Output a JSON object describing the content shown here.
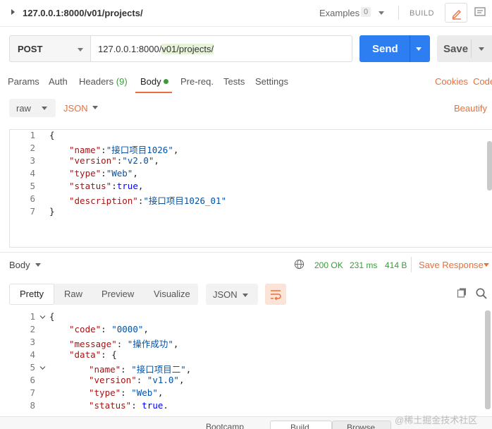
{
  "title_bar": {
    "request_title": "127.0.0.1:8000/v01/projects/",
    "examples_label": "Examples",
    "examples_count": "0",
    "build_label": "BUILD"
  },
  "request": {
    "method": "POST",
    "url_prefix": "127.0.0.1:8000/",
    "url_highlight": "v01/projects/",
    "send_label": "Send",
    "save_label": "Save"
  },
  "request_tabs": {
    "params": "Params",
    "auth": "Auth",
    "headers": "Headers",
    "headers_count": "(9)",
    "body": "Body",
    "prereq": "Pre-req.",
    "tests": "Tests",
    "settings": "Settings",
    "cookies": "Cookies",
    "code": "Code"
  },
  "body_options": {
    "mode": "raw",
    "type": "JSON",
    "beautify": "Beautify"
  },
  "request_body": {
    "line_numbers": [
      "1",
      "2",
      "3",
      "4",
      "5",
      "6",
      "7"
    ],
    "lines": [
      [
        {
          "t": "pun",
          "v": "{"
        }
      ],
      [
        {
          "t": "key",
          "v": "\"name\""
        },
        {
          "t": "pun",
          "v": ":"
        },
        {
          "t": "str",
          "v": "\"接口项目1026\""
        },
        {
          "t": "pun",
          "v": ","
        }
      ],
      [
        {
          "t": "key",
          "v": "\"version\""
        },
        {
          "t": "pun",
          "v": ":"
        },
        {
          "t": "str",
          "v": "\"v2.0\""
        },
        {
          "t": "pun",
          "v": ","
        }
      ],
      [
        {
          "t": "key",
          "v": "\"type\""
        },
        {
          "t": "pun",
          "v": ":"
        },
        {
          "t": "str",
          "v": "\"Web\""
        },
        {
          "t": "pun",
          "v": ","
        }
      ],
      [
        {
          "t": "key",
          "v": "\"status\""
        },
        {
          "t": "pun",
          "v": ":"
        },
        {
          "t": "kw",
          "v": "true"
        },
        {
          "t": "pun",
          "v": ","
        }
      ],
      [
        {
          "t": "key",
          "v": "\"description\""
        },
        {
          "t": "pun",
          "v": ":"
        },
        {
          "t": "str",
          "v": "\"接口项目1026_01\""
        }
      ],
      [
        {
          "t": "pun",
          "v": "}"
        }
      ]
    ]
  },
  "response": {
    "body_label": "Body",
    "status": "200 OK",
    "time": "231 ms",
    "size": "414 B",
    "save_response": "Save Response",
    "view_tabs": [
      "Pretty",
      "Raw",
      "Preview",
      "Visualize"
    ],
    "format": "JSON",
    "line_numbers": [
      "1",
      "2",
      "3",
      "4",
      "5",
      "6",
      "7",
      "8"
    ],
    "lines": [
      [
        {
          "t": "pun",
          "v": "{"
        }
      ],
      [
        {
          "t": "key",
          "v": "\"code\""
        },
        {
          "t": "pun",
          "v": ": "
        },
        {
          "t": "str",
          "v": "\"0000\""
        },
        {
          "t": "pun",
          "v": ","
        }
      ],
      [
        {
          "t": "key",
          "v": "\"message\""
        },
        {
          "t": "pun",
          "v": ": "
        },
        {
          "t": "str",
          "v": "\"操作成功\""
        },
        {
          "t": "pun",
          "v": ","
        }
      ],
      [
        {
          "t": "key",
          "v": "\"data\""
        },
        {
          "t": "pun",
          "v": ": {"
        }
      ],
      [
        {
          "t": "key",
          "v": "\"name\""
        },
        {
          "t": "pun",
          "v": ": "
        },
        {
          "t": "str",
          "v": "\"接口项目二\""
        },
        {
          "t": "pun",
          "v": ","
        }
      ],
      [
        {
          "t": "key",
          "v": "\"version\""
        },
        {
          "t": "pun",
          "v": ": "
        },
        {
          "t": "str",
          "v": "\"v1.0\""
        },
        {
          "t": "pun",
          "v": ","
        }
      ],
      [
        {
          "t": "key",
          "v": "\"type\""
        },
        {
          "t": "pun",
          "v": ": "
        },
        {
          "t": "str",
          "v": "\"Web\""
        },
        {
          "t": "pun",
          "v": ","
        }
      ],
      [
        {
          "t": "key",
          "v": "\"status\""
        },
        {
          "t": "pun",
          "v": ": "
        },
        {
          "t": "kw",
          "v": "true"
        },
        {
          "t": "pun",
          "v": "."
        }
      ]
    ]
  },
  "bottom_bar": {
    "bootcamp": "Bootcamp",
    "build": "Build",
    "browse": "Browse"
  },
  "watermark": "@稀土掘金技术社区",
  "colors": {
    "accent": "#e8703a",
    "send": "#2d7ef0",
    "success": "#3c9a3c"
  }
}
